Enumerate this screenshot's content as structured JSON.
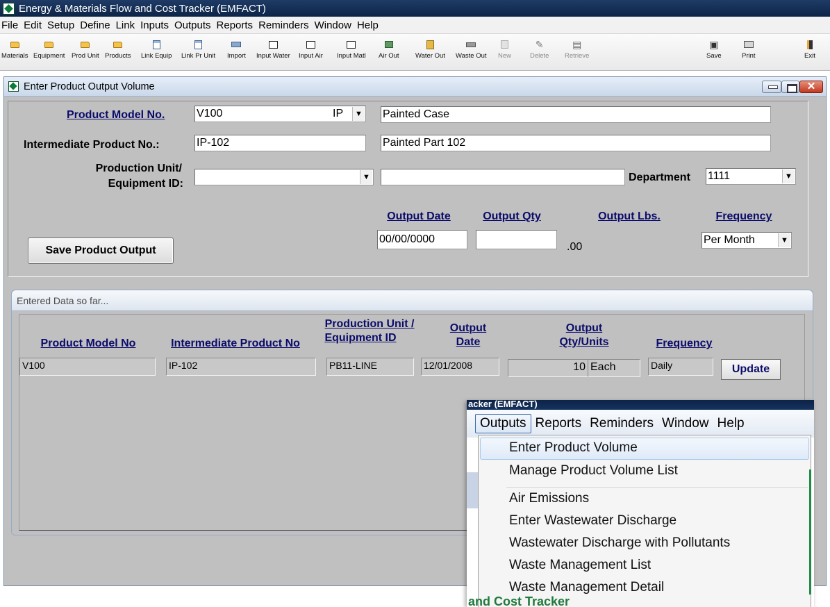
{
  "app": {
    "title": "Energy & Materials Flow and Cost Tracker (EMFACT)"
  },
  "menubar": [
    "File",
    "Edit",
    "Setup",
    "Define",
    "Link",
    "Inputs",
    "Outputs",
    "Reports",
    "Reminders",
    "Window",
    "Help"
  ],
  "toolbar": [
    {
      "label": "Materials",
      "icon": "folder-icon",
      "enabled": true
    },
    {
      "label": "Equipment",
      "icon": "folder-icon",
      "enabled": true
    },
    {
      "label": "Prod Unit",
      "icon": "folder-icon",
      "enabled": true
    },
    {
      "label": "Products",
      "icon": "folder-icon",
      "enabled": true
    },
    {
      "label": "Link Equip",
      "icon": "form-icon",
      "enabled": true
    },
    {
      "label": "Link Pr Unit",
      "icon": "form-icon",
      "enabled": true
    },
    {
      "label": "Import",
      "icon": "import-icon",
      "enabled": true
    },
    {
      "label": "Input Water",
      "icon": "input-form-icon",
      "enabled": true
    },
    {
      "label": "Input Air",
      "icon": "input-form-icon",
      "enabled": true
    },
    {
      "label": "Input Matl",
      "icon": "input-form-icon",
      "enabled": true
    },
    {
      "label": "Air Out",
      "icon": "air-out-icon",
      "enabled": true
    },
    {
      "label": "Water Out",
      "icon": "water-out-icon",
      "enabled": true
    },
    {
      "label": "Waste Out",
      "icon": "waste-out-icon",
      "enabled": true
    },
    {
      "label": "New",
      "icon": "new-icon",
      "enabled": false
    },
    {
      "label": "Delete",
      "icon": "delete-icon",
      "enabled": false
    },
    {
      "label": "Retrieve",
      "icon": "retrieve-icon",
      "enabled": false
    },
    {
      "label": "Save",
      "icon": "save-icon",
      "enabled": true
    },
    {
      "label": "Print",
      "icon": "print-icon",
      "enabled": true
    },
    {
      "label": "Exit",
      "icon": "exit-icon",
      "enabled": true
    }
  ],
  "window": {
    "title": "Enter Product Output Volume"
  },
  "form": {
    "product_model_label": "Product Model No.",
    "product_model_value": "V100",
    "product_model_suffix": "IP",
    "product_model_desc": "Painted Case",
    "intermediate_label": "Intermediate Product No.:",
    "intermediate_value": "IP-102",
    "intermediate_desc": "Painted Part 102",
    "production_unit_label_1": "Production Unit/",
    "production_unit_label_2": "Equipment ID:",
    "production_unit_value": "",
    "production_unit_desc": "",
    "department_label": "Department",
    "department_value": "1111",
    "output_date_label": "Output Date",
    "output_date_value": "00/00/0000",
    "output_qty_label": "Output Qty",
    "output_qty_value": "",
    "output_lbs_label": "Output Lbs.",
    "output_lbs_value": ".00",
    "frequency_label": "Frequency",
    "frequency_value": "Per Month",
    "save_button": "Save Product Output"
  },
  "entered": {
    "group_title": "Entered Data so far...",
    "headers": {
      "product_model": "Product Model No",
      "intermediate": "Intermediate Product No",
      "production_unit_1": "Production Unit /",
      "production_unit_2": "Equipment ID",
      "output_date_1": "Output",
      "output_date_2": "Date",
      "output_qty_1": "Output",
      "output_qty_2": "Qty/Units",
      "frequency": "Frequency"
    },
    "rows": [
      {
        "product_model": "V100",
        "intermediate": "IP-102",
        "production_unit": "PB11-LINE",
        "output_date": "12/01/2008",
        "output_qty": "10",
        "units": "Each",
        "frequency": "Daily",
        "update_label": "Update"
      }
    ]
  },
  "overlay": {
    "title_fragment": "acker (EMFACT)",
    "menubar": [
      "Outputs",
      "Reports",
      "Reminders",
      "Window",
      "Help"
    ],
    "menu_items": [
      "Enter Product Volume",
      "Manage Product Volume List",
      "Air Emissions",
      "Enter Wastewater Discharge",
      "Wastewater Discharge with Pollutants",
      "Waste Management List",
      "Waste Management Detail"
    ],
    "bottom_fragment": "and Cost Tracker"
  }
}
